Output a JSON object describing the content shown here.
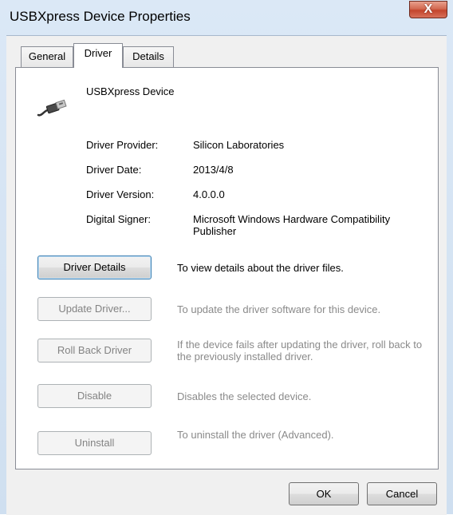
{
  "window": {
    "title": "USBXpress Device Properties",
    "close_label": "X"
  },
  "tabs": [
    {
      "label": "General",
      "active": false
    },
    {
      "label": "Driver",
      "active": true
    },
    {
      "label": "Details",
      "active": false
    }
  ],
  "device": {
    "name": "USBXpress Device",
    "icon": "usb-cable-icon"
  },
  "properties": {
    "provider_label": "Driver Provider:",
    "provider_value": "Silicon Laboratories",
    "date_label": "Driver Date:",
    "date_value": "2013/4/8",
    "version_label": "Driver Version:",
    "version_value": "4.0.0.0",
    "signer_label": "Digital Signer:",
    "signer_value": "Microsoft Windows Hardware Compatibility Publisher"
  },
  "actions": [
    {
      "label": "Driver Details",
      "description": "To view details about the driver files.",
      "enabled": true
    },
    {
      "label": "Update Driver...",
      "description": "To update the driver software for this device.",
      "enabled": false
    },
    {
      "label": "Roll Back Driver",
      "description": "If the device fails after updating the driver, roll back to the previously installed driver.",
      "enabled": false
    },
    {
      "label": "Disable",
      "description": "Disables the selected device.",
      "enabled": false
    },
    {
      "label": "Uninstall",
      "description": "To uninstall the driver (Advanced).",
      "enabled": false
    }
  ],
  "footer": {
    "ok_label": "OK",
    "cancel_label": "Cancel"
  },
  "colors": {
    "close_button": "#c3452c",
    "frame": "#cfdff0",
    "disabled_text": "#8a8a8a"
  }
}
